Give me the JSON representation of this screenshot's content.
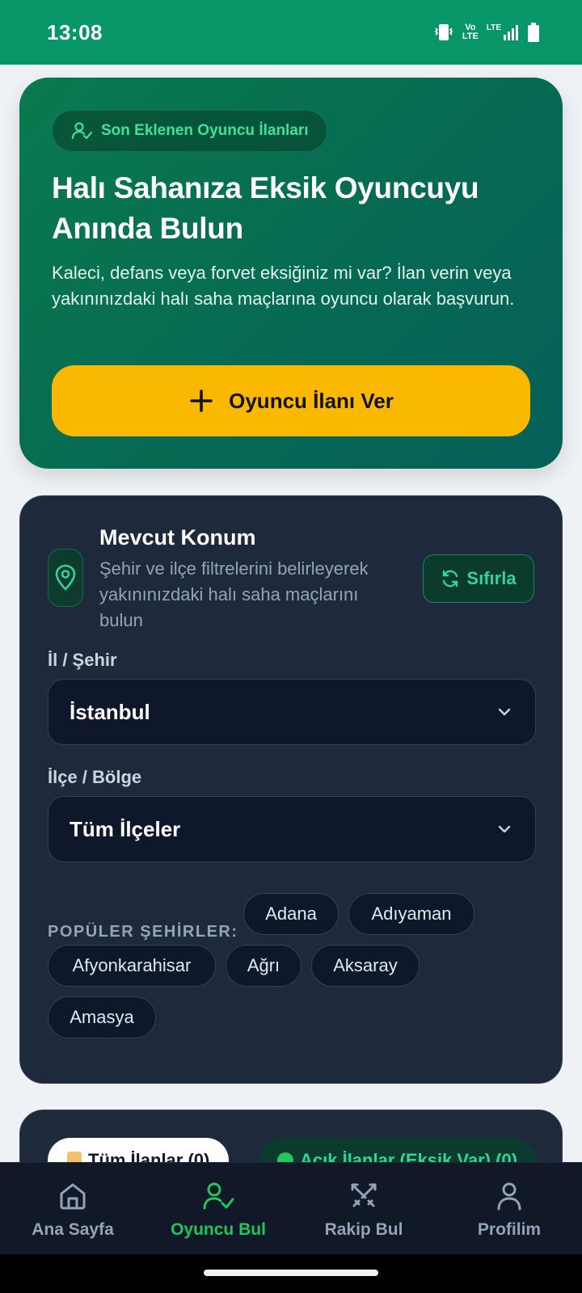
{
  "status_bar": {
    "time": "13:08",
    "icons": [
      "vibrate-icon",
      "volte-icon",
      "lte-signal-icon",
      "battery-icon"
    ],
    "volte_text": "Vo LTE",
    "lte_text": "LTE"
  },
  "hero": {
    "badge_label": "Son Eklenen Oyuncu İlanları",
    "title": "Halı Sahanıza Eksik Oyuncuyu Anında Bulun",
    "description": "Kaleci, defans veya forvet eksiğiniz mi var? İlan verin veya yakınınızdaki halı saha maçlarına oyuncu olarak başvurun.",
    "cta_label": "Oyuncu İlanı Ver",
    "colors": {
      "cta": "#fbb800",
      "badge_text": "#42e09a"
    }
  },
  "location": {
    "title": "Mevcut Konum",
    "description": "Şehir ve ilçe filtrelerini belirleyerek yakınınızdaki halı saha maçlarını bulun",
    "reset_label": "Sıfırla"
  },
  "filters": {
    "city_label": "İl / Şehir",
    "city_value": "İstanbul",
    "district_label": "İlçe / Bölge",
    "district_value": "Tüm İlçeler"
  },
  "popular": {
    "label": "POPÜLER ŞEHİRLER:",
    "cities": [
      "Adana",
      "Adıyaman",
      "Afyonkarahisar",
      "Ağrı",
      "Aksaray",
      "Amasya"
    ]
  },
  "tabs": {
    "all_label": "Tüm İlanlar (0)",
    "open_label": "Açık İlanlar (Eksik Var) (0)"
  },
  "bottom_nav": {
    "items": [
      {
        "label": "Ana Sayfa",
        "icon": "home-icon"
      },
      {
        "label": "Oyuncu Bul",
        "icon": "user-check-icon"
      },
      {
        "label": "Rakip Bul",
        "icon": "swords-icon"
      },
      {
        "label": "Profilim",
        "icon": "profile-icon"
      }
    ],
    "active_index": 1,
    "colors": {
      "active": "#22c55e",
      "inactive": "#94a3b8"
    }
  }
}
